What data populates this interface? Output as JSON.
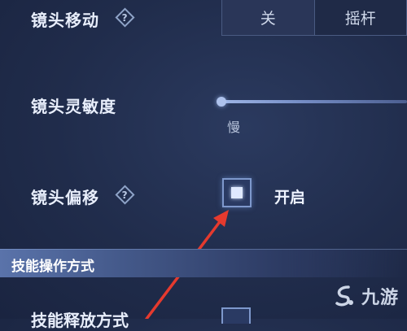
{
  "settings": {
    "camera_move": {
      "label": "镜头移动",
      "options": [
        "关",
        "摇杆"
      ]
    },
    "camera_sensitivity": {
      "label": "镜头灵敏度",
      "min_label": "慢",
      "value_fraction": 0.0
    },
    "camera_offset": {
      "label": "镜头偏移",
      "checkbox_label": "开启",
      "checked": true
    }
  },
  "section": {
    "title": "技能操作方式"
  },
  "partial_row": {
    "label": "技能释放方式"
  },
  "watermark": {
    "icon": "jiuyou-logo",
    "text": "九游"
  },
  "colors": {
    "annotation_arrow": "#e53a2e",
    "accent": "#7e98cc"
  }
}
